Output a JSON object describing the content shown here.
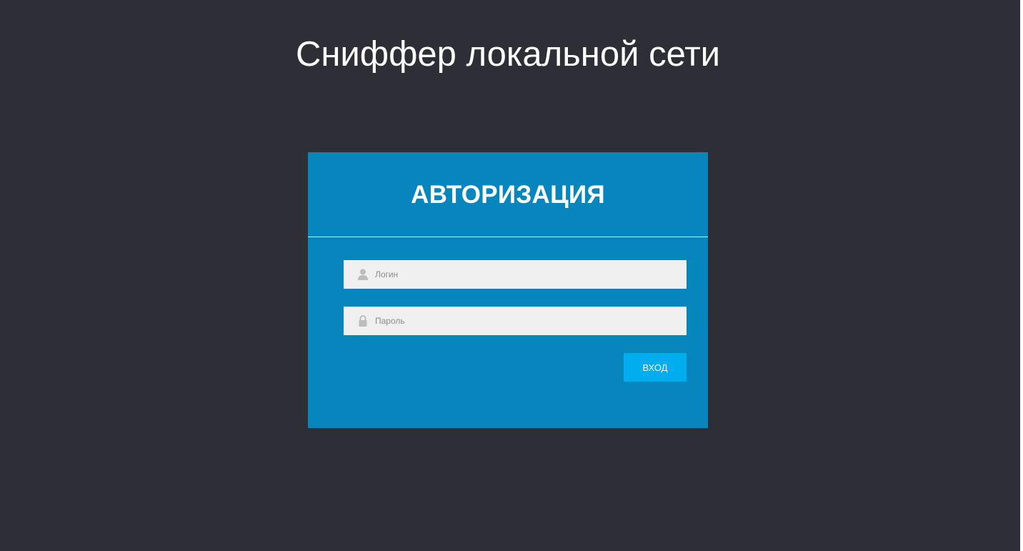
{
  "page": {
    "title": "Сниффер локальной сети"
  },
  "auth_form": {
    "heading": "АВТОРИЗАЦИЯ",
    "login_field": {
      "placeholder": "Логин",
      "value": "",
      "icon": "user-icon"
    },
    "password_field": {
      "placeholder": "Пароль",
      "value": "",
      "icon": "lock-icon"
    },
    "submit_label": "ВХОД"
  },
  "colors": {
    "background": "#2d2e36",
    "card": "#0785bd",
    "input_bg": "#f0f0f0",
    "button": "#00aeef",
    "text_light": "#ffffff"
  }
}
